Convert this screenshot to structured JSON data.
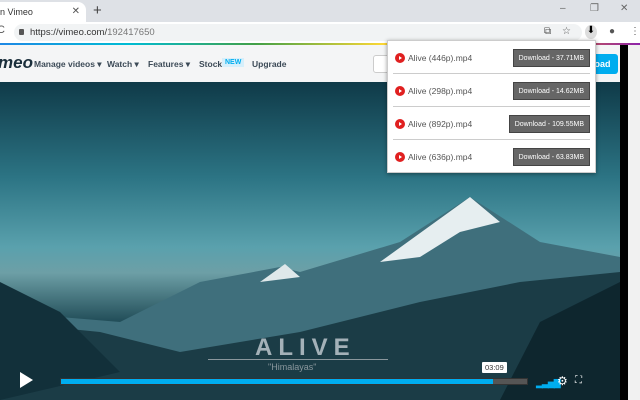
{
  "browser": {
    "tab_title": "n Vimeo",
    "url_host": "https://vimeo.com/",
    "url_path": "192417650"
  },
  "nav": {
    "logo": "meo",
    "items": [
      "Manage videos ▾",
      "Watch ▾",
      "Features ▾",
      "Stock"
    ],
    "new_badge": "NEW",
    "upgrade": "Upgrade",
    "upload": "load"
  },
  "video": {
    "title": "ALIVE",
    "subtitle": "\"Himalayas\"",
    "time": "03:09",
    "progress_fraction": 0.927
  },
  "downloads": [
    {
      "file": "Alive (446p).mp4",
      "button": "Download - 37.71MB"
    },
    {
      "file": "Alive (298p).mp4",
      "button": "Download - 14.62MB"
    },
    {
      "file": "Alive (892p).mp4",
      "button": "Download - 109.55MB"
    },
    {
      "file": "Alive (636p).mp4",
      "button": "Download - 63.83MB"
    }
  ],
  "colors": {
    "accent": "#00adef",
    "red": "#e02020"
  }
}
